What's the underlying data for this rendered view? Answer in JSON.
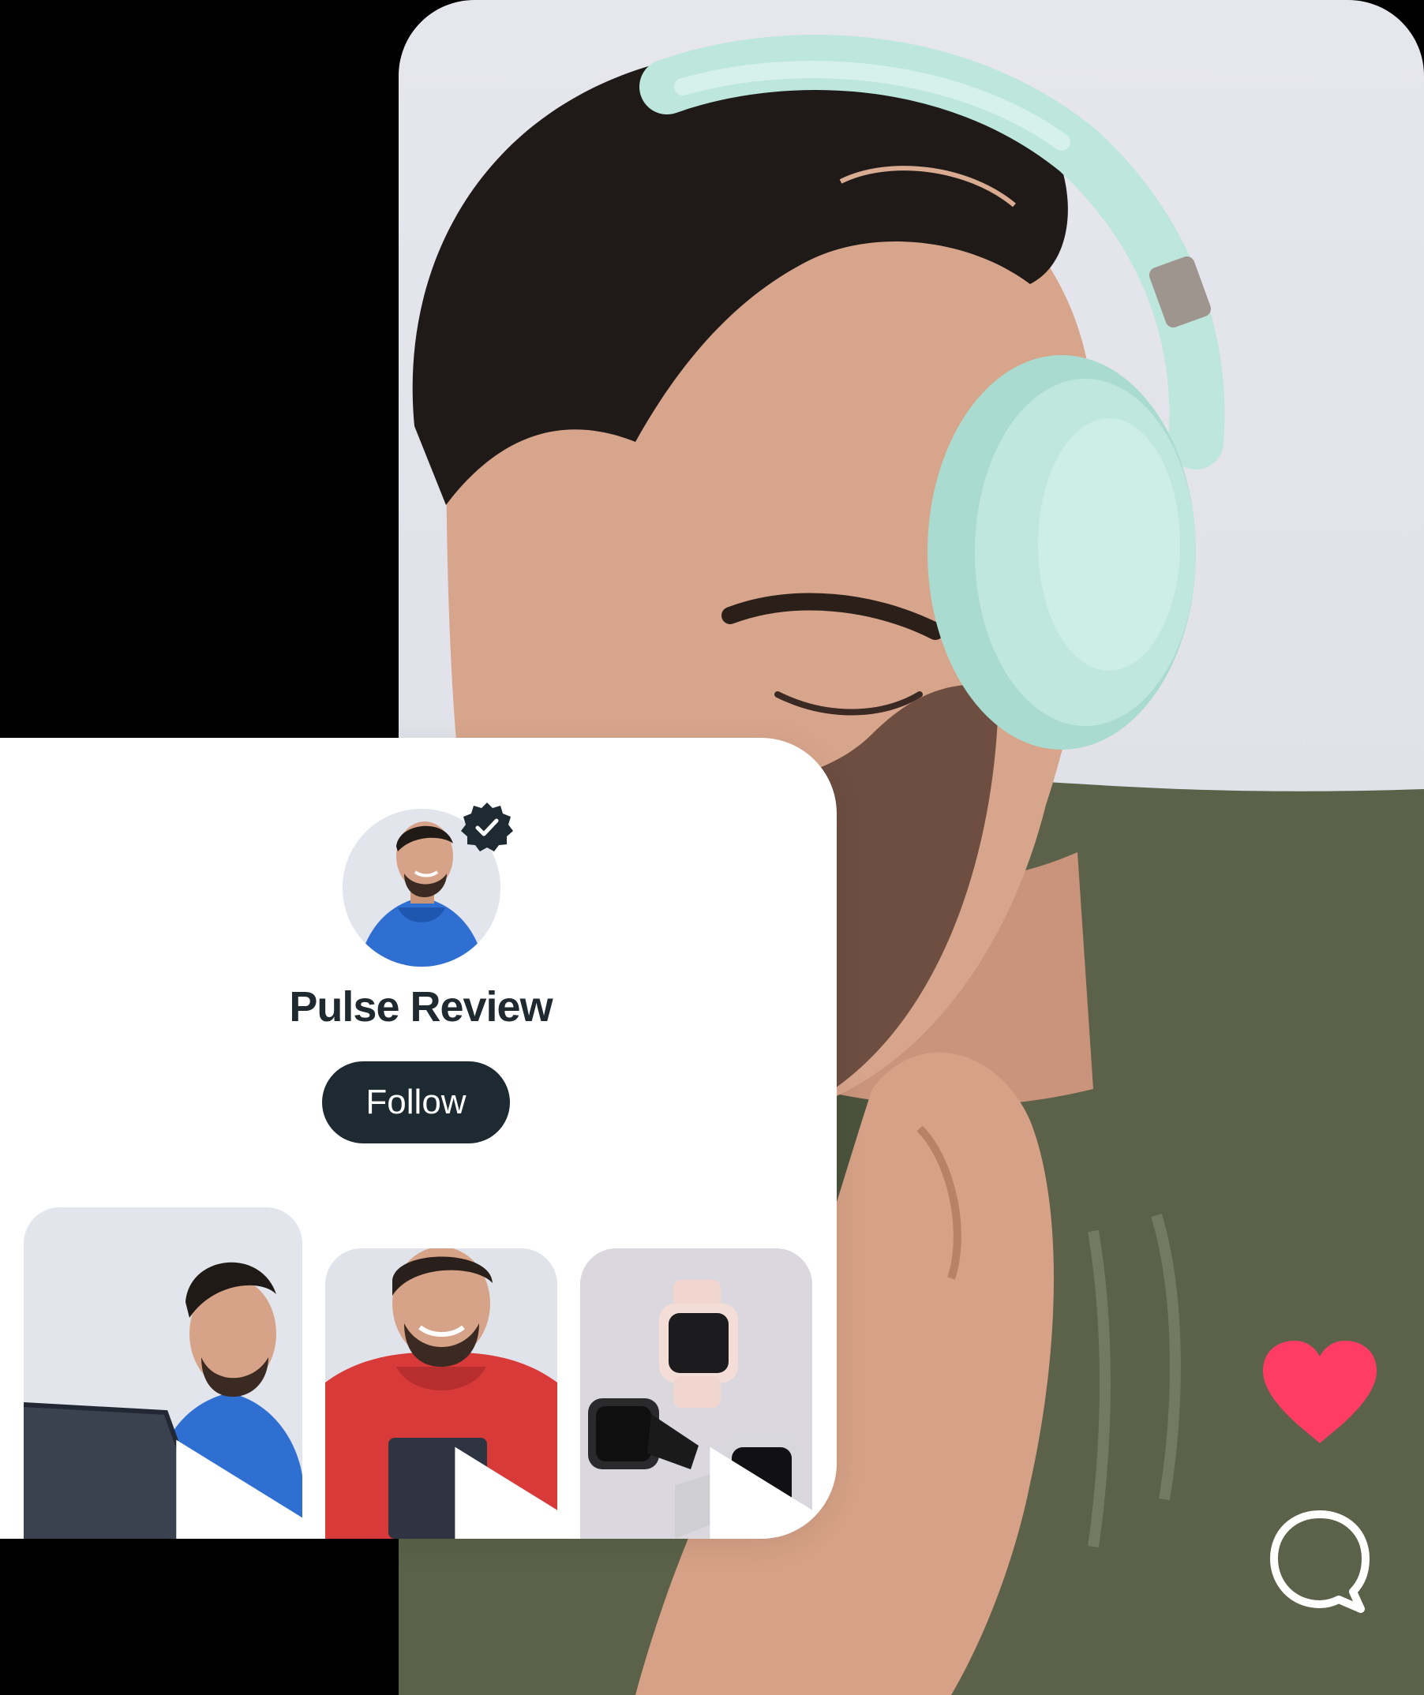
{
  "profile": {
    "name": "Pulse Review",
    "follow_label": "Follow",
    "verified": true
  },
  "hero": {
    "subject": "man-with-headphones-photo"
  },
  "actions": {
    "like_icon": "heart-icon",
    "comment_icon": "comment-icon"
  },
  "videos": [
    {
      "icon": "play-icon",
      "thumb": "laptop-review"
    },
    {
      "icon": "play-icon",
      "thumb": "tablet-review"
    },
    {
      "icon": "play-icon",
      "thumb": "smartwatch-review"
    }
  ],
  "colors": {
    "like": "#ff3d64",
    "follow_bg": "#1e2a31",
    "name_text": "#1f2a30",
    "headphones": "#b8e4da",
    "hoodie": "#5a6148"
  }
}
